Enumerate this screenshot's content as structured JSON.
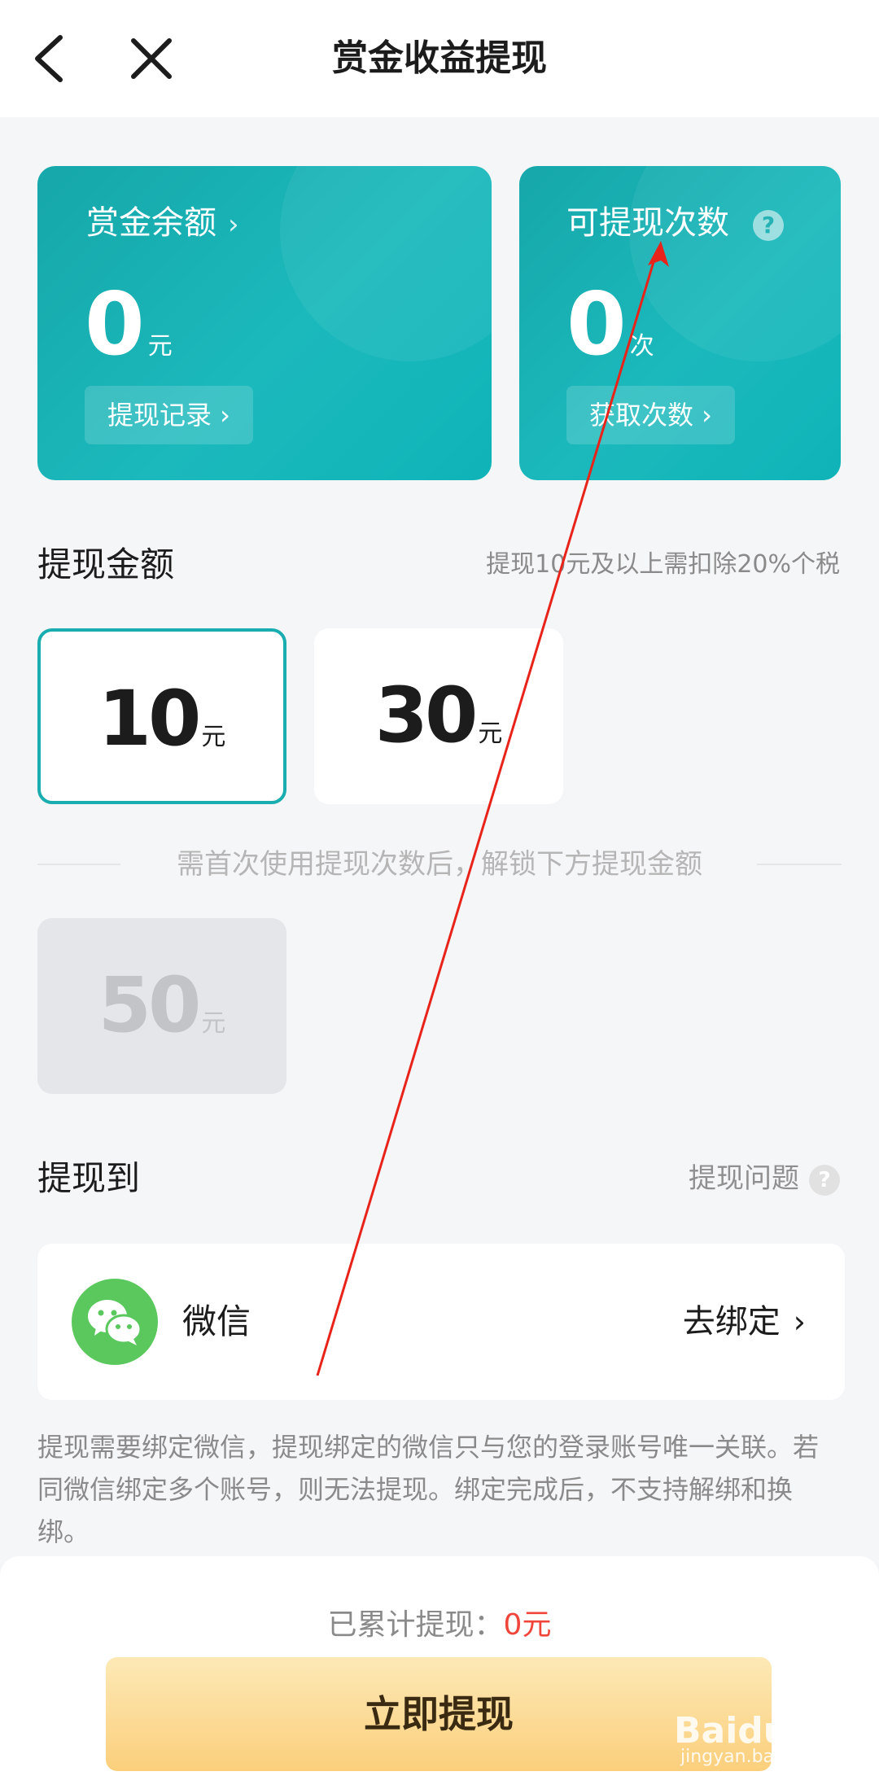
{
  "header": {
    "title": "赏金收益提现"
  },
  "balance_card": {
    "title": "赏金余额",
    "value": "0",
    "unit": "元",
    "record_button": "提现记录 ›"
  },
  "times_card": {
    "title": "可提现次数",
    "value": "0",
    "unit": "次",
    "get_button": "获取次数 ›",
    "help": "?"
  },
  "amount_section": {
    "title": "提现金额",
    "tax_note": "提现10元及以上需扣除20%个税",
    "options": [
      {
        "value": "10",
        "unit": "元"
      },
      {
        "value": "30",
        "unit": "元"
      }
    ],
    "unlock_note": "需首次使用提现次数后，解锁下方提现金额",
    "locked_option": {
      "value": "50",
      "unit": "元"
    }
  },
  "destination_section": {
    "title": "提现到",
    "help_link": "提现问题",
    "help": "?",
    "method": "微信",
    "bind_action": "去绑定",
    "bind_chevron": "›"
  },
  "bind_notice": "提现需要绑定微信，提现绑定的微信只与您的登录账号唯一关联。若同微信绑定多个账号，则无法提现。绑定完成后，不支持解绑和换绑。",
  "footer": {
    "total_label": "已累计提现：",
    "total_value": "0元",
    "withdraw_button": "立即提现"
  },
  "watermark": {
    "brand": "Baidu经验",
    "url": "jingyan.baidu.com"
  },
  "colors": {
    "teal": "#1aadb0",
    "red_value": "#f0453a",
    "button_gold": "#fbcf7c",
    "wechat_green": "#5bc85e",
    "annotation_arrow": "#e8231a"
  }
}
